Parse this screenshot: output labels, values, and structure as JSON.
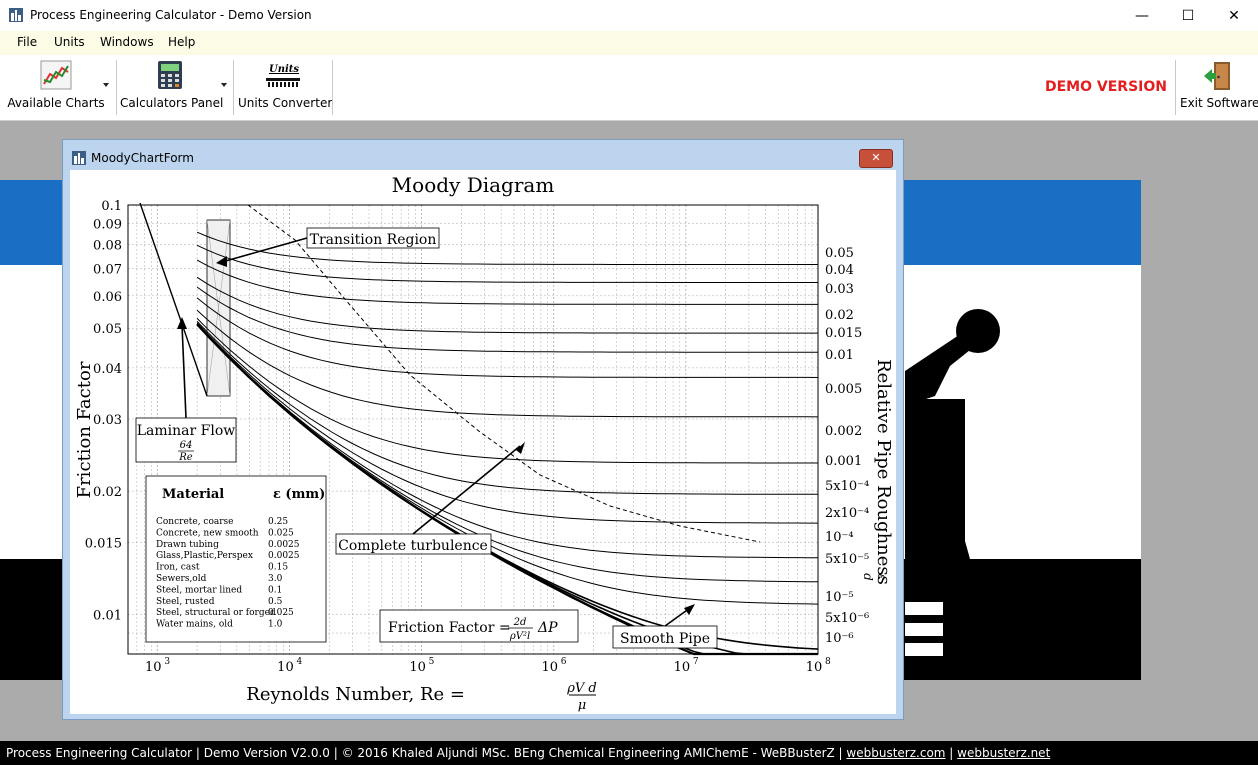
{
  "window": {
    "title": "Process Engineering Calculator - Demo Version"
  },
  "menu": [
    "File",
    "Units",
    "Windows",
    "Help"
  ],
  "toolbar": {
    "available_charts": "Available Charts",
    "calculators_panel": "Calculators Panel",
    "units_converter": "Units Converter",
    "units_icon_text": "Units",
    "demo": "DEMO VERSION",
    "exit": "Exit Software"
  },
  "child": {
    "title": "MoodyChartForm",
    "close_symbol": "✕"
  },
  "chart": {
    "title": "Moody Diagram",
    "ylabel": "Friction Factor",
    "xlabel": "Reynolds Number, Re =",
    "xlabel_frac_num": "ρV d",
    "xlabel_frac_den": "μ",
    "right_label": "Relative Pipe Roughness",
    "right_label_frac_num": "ε",
    "right_label_frac_den": "d",
    "yticks": [
      "0.1",
      "0.09",
      "0.08",
      "0.07",
      "0.06",
      "0.05",
      "0.04",
      "0.03",
      "0.02",
      "0.015",
      "0.01"
    ],
    "xticks": [
      {
        "base": "10",
        "exp": "3"
      },
      {
        "base": "10",
        "exp": "4"
      },
      {
        "base": "10",
        "exp": "5"
      },
      {
        "base": "10",
        "exp": "6"
      },
      {
        "base": "10",
        "exp": "7"
      },
      {
        "base": "10",
        "exp": "8"
      }
    ],
    "roughness_labels": [
      "0.05",
      "0.04",
      "0.03",
      "0.02",
      "0.015",
      "0.01",
      "0.005",
      "0.002",
      "0.001",
      "5x10⁻⁴",
      "2x10⁻⁴",
      "10⁻⁴",
      "5x10⁻⁵",
      "10⁻⁵",
      "5x10⁻⁶",
      "10⁻⁶"
    ],
    "annotations": {
      "transition": "Transition Region",
      "laminar": "Laminar Flow",
      "laminar_num": "64",
      "laminar_den": "Re",
      "complete": "Complete turbulence",
      "smooth": "Smooth Pipe",
      "ff_formula": "Friction Factor =",
      "ff_num": "2d",
      "ff_den": "ρV²l",
      "ff_tail": "ΔP"
    },
    "material_table": {
      "header_material": "Material",
      "header_eps": "ε (mm)",
      "rows": [
        [
          "Concrete, coarse",
          "0.25"
        ],
        [
          "Concrete, new smooth",
          "0.025"
        ],
        [
          "Drawn tubing",
          "0.0025"
        ],
        [
          "Glass,Plastic,Perspex",
          "0.0025"
        ],
        [
          "Iron, cast",
          "0.15"
        ],
        [
          "Sewers,old",
          "3.0"
        ],
        [
          "Steel, mortar lined",
          "0.1"
        ],
        [
          "Steel, rusted",
          "0.5"
        ],
        [
          "Steel, structural or forged",
          "0.025"
        ],
        [
          "Water mains, old",
          "1.0"
        ]
      ]
    }
  },
  "chart_data": {
    "type": "line",
    "title": "Moody Diagram",
    "xlabel": "Reynolds Number, Re = ρVd/μ",
    "ylabel": "Friction Factor",
    "x_scale": "log",
    "y_scale": "log",
    "xlim": [
      600,
      100000000
    ],
    "ylim": [
      0.008,
      0.1
    ],
    "grid": true,
    "series": [
      {
        "name": "Laminar Flow 64/Re",
        "x": [
          640,
          2000
        ],
        "y": [
          0.1,
          0.032
        ]
      },
      {
        "name": "0.05",
        "x": [
          2000,
          100000000
        ],
        "y": [
          0.088,
          0.0718
        ]
      },
      {
        "name": "0.04",
        "x": [
          2000,
          100000000
        ],
        "y": [
          0.082,
          0.0649
        ]
      },
      {
        "name": "0.03",
        "x": [
          2000,
          100000000
        ],
        "y": [
          0.076,
          0.0571
        ]
      },
      {
        "name": "0.02",
        "x": [
          2000,
          100000000
        ],
        "y": [
          0.069,
          0.049
        ]
      },
      {
        "name": "0.015",
        "x": [
          2000,
          100000000
        ],
        "y": [
          0.065,
          0.0439
        ]
      },
      {
        "name": "0.01",
        "x": [
          2000,
          100000000
        ],
        "y": [
          0.061,
          0.0379
        ]
      },
      {
        "name": "0.005",
        "x": [
          2000,
          100000000
        ],
        "y": [
          0.057,
          0.0304
        ]
      },
      {
        "name": "0.002",
        "x": [
          2000,
          100000000
        ],
        "y": [
          0.054,
          0.0234
        ]
      },
      {
        "name": "0.001",
        "x": [
          2000,
          100000000
        ],
        "y": [
          0.053,
          0.0199
        ]
      },
      {
        "name": "5x10^-4",
        "x": [
          2000,
          100000000
        ],
        "y": [
          0.052,
          0.0167
        ]
      },
      {
        "name": "2x10^-4",
        "x": [
          2000,
          100000000
        ],
        "y": [
          0.052,
          0.0137
        ]
      },
      {
        "name": "10^-4",
        "x": [
          2000,
          100000000
        ],
        "y": [
          0.052,
          0.012
        ]
      },
      {
        "name": "5x10^-5",
        "x": [
          2000,
          100000000
        ],
        "y": [
          0.052,
          0.0105
        ]
      },
      {
        "name": "10^-5",
        "x": [
          2000,
          100000000
        ],
        "y": [
          0.052,
          0.0085
        ]
      },
      {
        "name": "5x10^-6",
        "x": [
          2000,
          100000000
        ],
        "y": [
          0.052,
          0.008
        ]
      },
      {
        "name": "10^-6",
        "x": [
          2000,
          100000000
        ],
        "y": [
          0.052,
          0.0078
        ]
      }
    ]
  },
  "status": {
    "text": "Process Engineering Calculator  |  Demo Version V2.0.0  |  © 2016 Khaled Aljundi MSc. BEng Chemical Engineering AMIChemE - WeBBusterZ  |  ",
    "link1": "webbusterz.com",
    "sep": "  |  ",
    "link2": "webbusterz.net"
  }
}
